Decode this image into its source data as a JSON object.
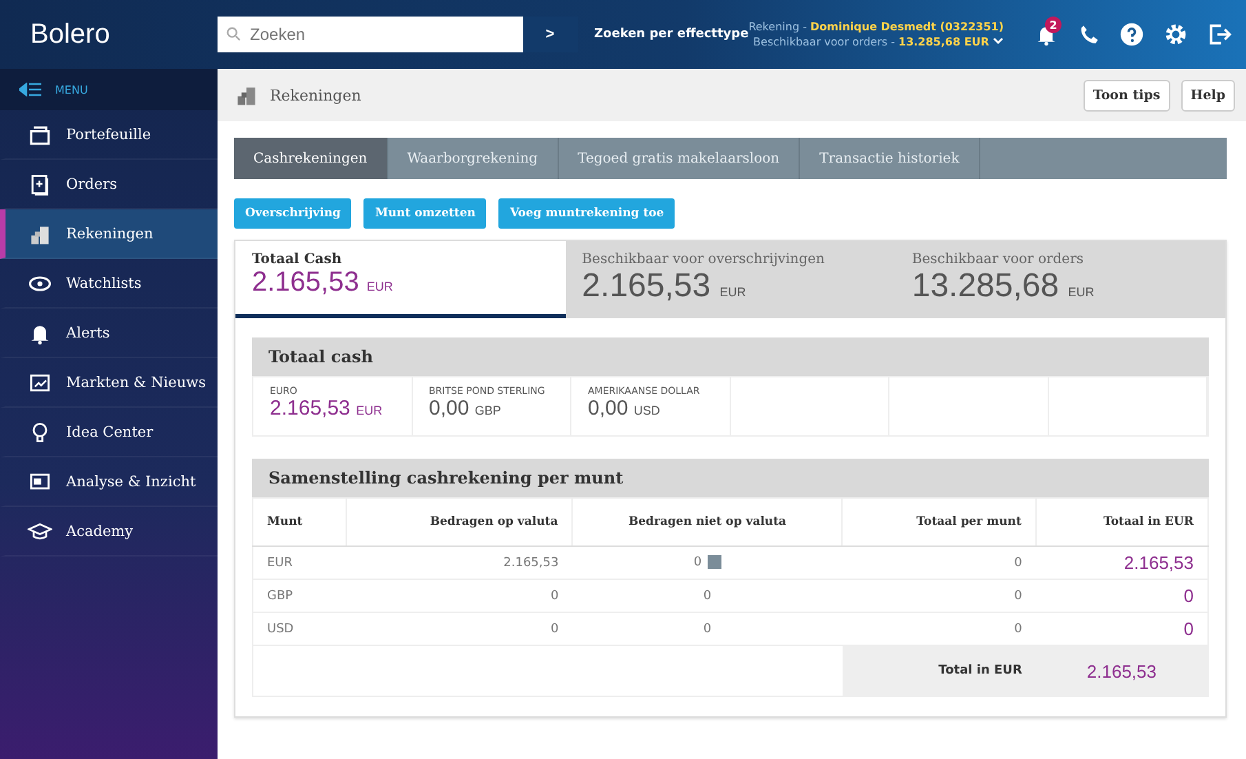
{
  "header": {
    "logo": "Bolero",
    "search": {
      "placeholder": "Zoeken",
      "go": ">"
    },
    "search_by_type": "Zoeken per effecttype",
    "account": {
      "label": "Rekening - ",
      "name": "Dominique Desmedt  (0322351)",
      "available_label": "Beschikbaar voor orders - ",
      "available": "13.285,68 EUR"
    },
    "notifications": "2"
  },
  "sidebar": {
    "menu": "MENU",
    "items": [
      {
        "label": "Portefeuille",
        "selected": false
      },
      {
        "label": "Orders",
        "selected": false
      },
      {
        "label": "Rekeningen",
        "selected": true
      },
      {
        "label": "Watchlists",
        "selected": false
      },
      {
        "label": "Alerts",
        "selected": false
      },
      {
        "label": "Markten & Nieuws",
        "selected": false
      },
      {
        "label": "Idea Center",
        "selected": false
      },
      {
        "label": "Analyse & Inzicht",
        "selected": false
      },
      {
        "label": "Academy",
        "selected": false
      }
    ]
  },
  "page": {
    "title": "Rekeningen",
    "buttons": [
      "Toon tips",
      "Help"
    ]
  },
  "tabs": [
    {
      "label": "Cashrekeningen",
      "selected": true
    },
    {
      "label": "Waarborgrekening",
      "selected": false
    },
    {
      "label": "Tegoed gratis makelaarsloon",
      "selected": false
    },
    {
      "label": "Transactie historiek",
      "selected": false
    }
  ],
  "actions": [
    "Overschrijving",
    "Munt omzetten",
    "Voeg muntrekening toe"
  ],
  "summary": [
    {
      "label": "Totaal Cash",
      "value": "2.165,53",
      "currency": "EUR",
      "selected": true
    },
    {
      "label": "Beschikbaar voor overschrijvingen",
      "value": "2.165,53",
      "currency": "EUR",
      "selected": false
    },
    {
      "label": "Beschikbaar voor orders",
      "value": "13.285,68",
      "currency": "EUR",
      "selected": false
    }
  ],
  "total_cash": {
    "title": "Totaal cash",
    "currencies": [
      {
        "name": "EURO",
        "value": "2.165,53",
        "code": "EUR",
        "highlight": true
      },
      {
        "name": "BRITSE POND STERLING",
        "value": "0,00",
        "code": "GBP",
        "highlight": false
      },
      {
        "name": "AMERIKAANSE DOLLAR",
        "value": "0,00",
        "code": "USD",
        "highlight": false
      }
    ]
  },
  "composition": {
    "title": "Samenstelling cashrekening per munt",
    "columns": [
      "Munt",
      "Bedragen op valuta",
      "Bedragen niet op valuta",
      "Totaal per munt",
      "Totaal in EUR"
    ],
    "rows": [
      {
        "cells": [
          "EUR",
          "2.165,53",
          "0",
          "0",
          "2.165,53"
        ],
        "info": true
      },
      {
        "cells": [
          "GBP",
          "0",
          "0",
          "0",
          "0"
        ],
        "info": false
      },
      {
        "cells": [
          "USD",
          "0",
          "0",
          "0",
          "0"
        ],
        "info": false
      }
    ],
    "total_label": "Total in EUR",
    "total": "2.165,53"
  }
}
